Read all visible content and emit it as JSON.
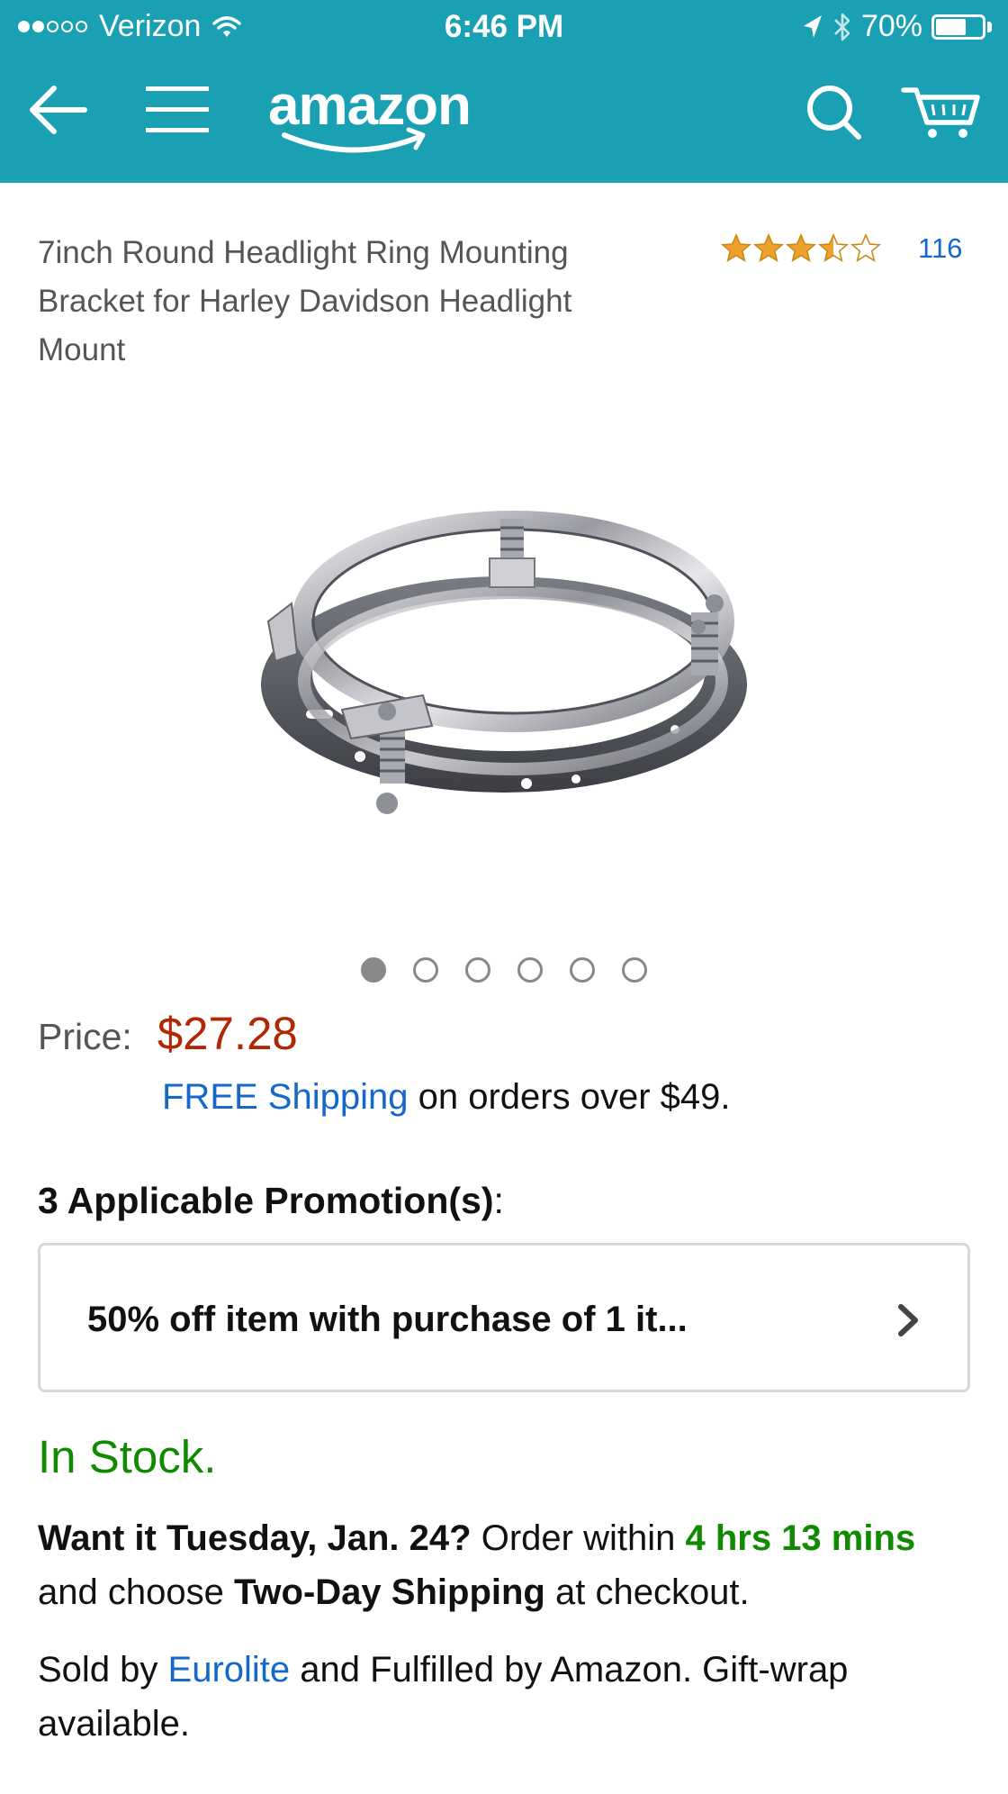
{
  "status_bar": {
    "carrier": "Verizon",
    "signal_bars_filled": 2,
    "signal_bars_total": 5,
    "time": "6:46 PM",
    "battery_percent": "70%",
    "battery_level": 0.7
  },
  "nav": {
    "logo_text": "amazon",
    "icons": [
      "back-arrow-icon",
      "hamburger-menu-icon",
      "search-icon",
      "cart-icon"
    ]
  },
  "product": {
    "title": "7inch Round Headlight Ring Mounting Bracket for Harley Davidson Headlight Mount",
    "rating_stars": 3.5,
    "rating_count": "116",
    "image_count": 6,
    "active_image": 1
  },
  "price": {
    "label": "Price:",
    "value": "$27.28"
  },
  "shipping": {
    "link_text": "FREE Shipping",
    "suffix": " on orders over $49."
  },
  "promotions": {
    "heading": "3 Applicable Promotion(s)",
    "colon": ":",
    "item": "50% off item with purchase of 1 it..."
  },
  "availability": {
    "stock": "In Stock.",
    "want_it": "Want it Tuesday, Jan. 24?",
    "order_within": " Order within ",
    "countdown": "4 hrs 13 mins",
    "and_choose": " and choose ",
    "shipping_option": "Two-Day Shipping",
    "at_checkout": " at checkout."
  },
  "seller": {
    "sold_by": "Sold by ",
    "seller_name": "Eurolite",
    "rest": " and Fulfilled by Amazon. Gift-wrap available."
  },
  "colors": {
    "nav_bg": "#1aa0b3",
    "price": "#b12704",
    "link": "#1468c9",
    "in_stock": "#108a00",
    "star": "#f0a12b"
  }
}
